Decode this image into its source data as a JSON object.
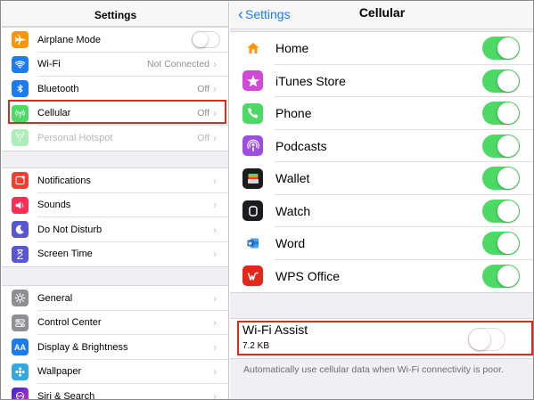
{
  "left": {
    "title": "Settings",
    "group1": [
      {
        "label": "Airplane Mode",
        "value": "",
        "icon": "airplane-icon",
        "color": "#ff9500",
        "type": "toggle"
      },
      {
        "label": "Wi-Fi",
        "value": "Not Connected",
        "icon": "wifi-icon",
        "color": "#1a7cf5",
        "type": "link"
      },
      {
        "label": "Bluetooth",
        "value": "Off",
        "icon": "bluetooth-icon",
        "color": "#1a7cf5",
        "type": "link"
      },
      {
        "label": "Cellular",
        "value": "Off",
        "icon": "cellular-icon",
        "color": "#4cd964",
        "type": "link"
      },
      {
        "label": "Personal Hotspot",
        "value": "Off",
        "icon": "hotspot-icon",
        "color": "#4cd964",
        "type": "disabled"
      }
    ],
    "group2": [
      {
        "label": "Notifications",
        "icon": "notifications-icon",
        "color": "#ff3b30"
      },
      {
        "label": "Sounds",
        "icon": "sounds-icon",
        "color": "#ff2d55"
      },
      {
        "label": "Do Not Disturb",
        "icon": "moon-icon",
        "color": "#5856d6"
      },
      {
        "label": "Screen Time",
        "icon": "hourglass-icon",
        "color": "#5856d6"
      }
    ],
    "group3": [
      {
        "label": "General",
        "icon": "gear-icon",
        "color": "#8e8e93"
      },
      {
        "label": "Control Center",
        "icon": "control-center-icon",
        "color": "#8e8e93"
      },
      {
        "label": "Display & Brightness",
        "icon": "display-icon",
        "color": "#1a7cf5",
        "glyph": "AA"
      },
      {
        "label": "Wallpaper",
        "icon": "wallpaper-icon",
        "color": "#34aadc"
      },
      {
        "label": "Siri & Search",
        "icon": "siri-icon",
        "color": "#222222"
      }
    ]
  },
  "right": {
    "back_label": "Settings",
    "title": "Cellular",
    "apps": [
      {
        "label": "Home",
        "icon": "home-icon",
        "color": "#ffffff",
        "on": true
      },
      {
        "label": "iTunes Store",
        "icon": "itunes-star-icon",
        "color": "#d14ad6",
        "on": true
      },
      {
        "label": "Phone",
        "icon": "phone-icon",
        "color": "#4cd964",
        "on": true
      },
      {
        "label": "Podcasts",
        "icon": "podcasts-icon",
        "color": "#9b4fe0",
        "on": true
      },
      {
        "label": "Wallet",
        "icon": "wallet-icon",
        "color": "#1c1c1e",
        "on": true
      },
      {
        "label": "Watch",
        "icon": "watch-icon",
        "color": "#1c1c1e",
        "on": true
      },
      {
        "label": "Word",
        "icon": "word-icon",
        "color": "#ffffff",
        "on": true
      },
      {
        "label": "WPS Office",
        "icon": "wps-office-icon",
        "color": "#e2271b",
        "on": true
      }
    ],
    "wifi_assist": {
      "title": "Wi-Fi Assist",
      "size": "7.2 KB",
      "on": false,
      "note": "Automatically use cellular data when Wi-Fi connectivity is poor."
    }
  },
  "colors": {
    "accent": "#1a7cf5",
    "toggle_on": "#4cd964",
    "highlight": "#e2271b"
  }
}
